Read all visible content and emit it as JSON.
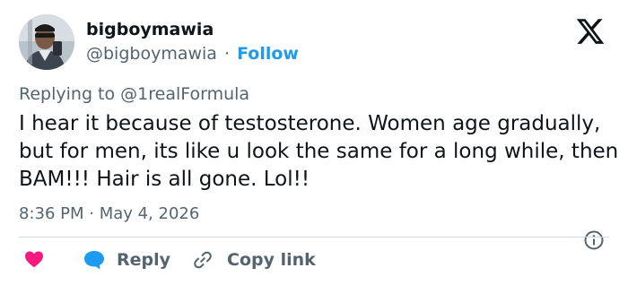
{
  "author": {
    "display_name": "bigboymawia",
    "handle": "@bigboymawia",
    "separator": "·",
    "follow_label": "Follow"
  },
  "reply_context": "Replying to @1realFormula",
  "tweet": {
    "text": "I hear it because of testosterone. Women age gradually, but for men, its like u look the same for a long while, then BAM!!! Hair is all gone. Lol!!",
    "timestamp": "8:36 PM · May 4, 2026"
  },
  "actions": {
    "reply_label": "Reply",
    "copy_label": "Copy link"
  },
  "icons": {
    "brand": "x-logo-icon",
    "like": "heart-icon",
    "reply": "speech-bubble-icon",
    "copy": "link-icon",
    "info": "info-icon"
  },
  "colors": {
    "accent": "#1d9bf0",
    "like": "#f91880",
    "text": "#0f1419",
    "secondary": "#536471",
    "divider": "#cfd9de"
  }
}
